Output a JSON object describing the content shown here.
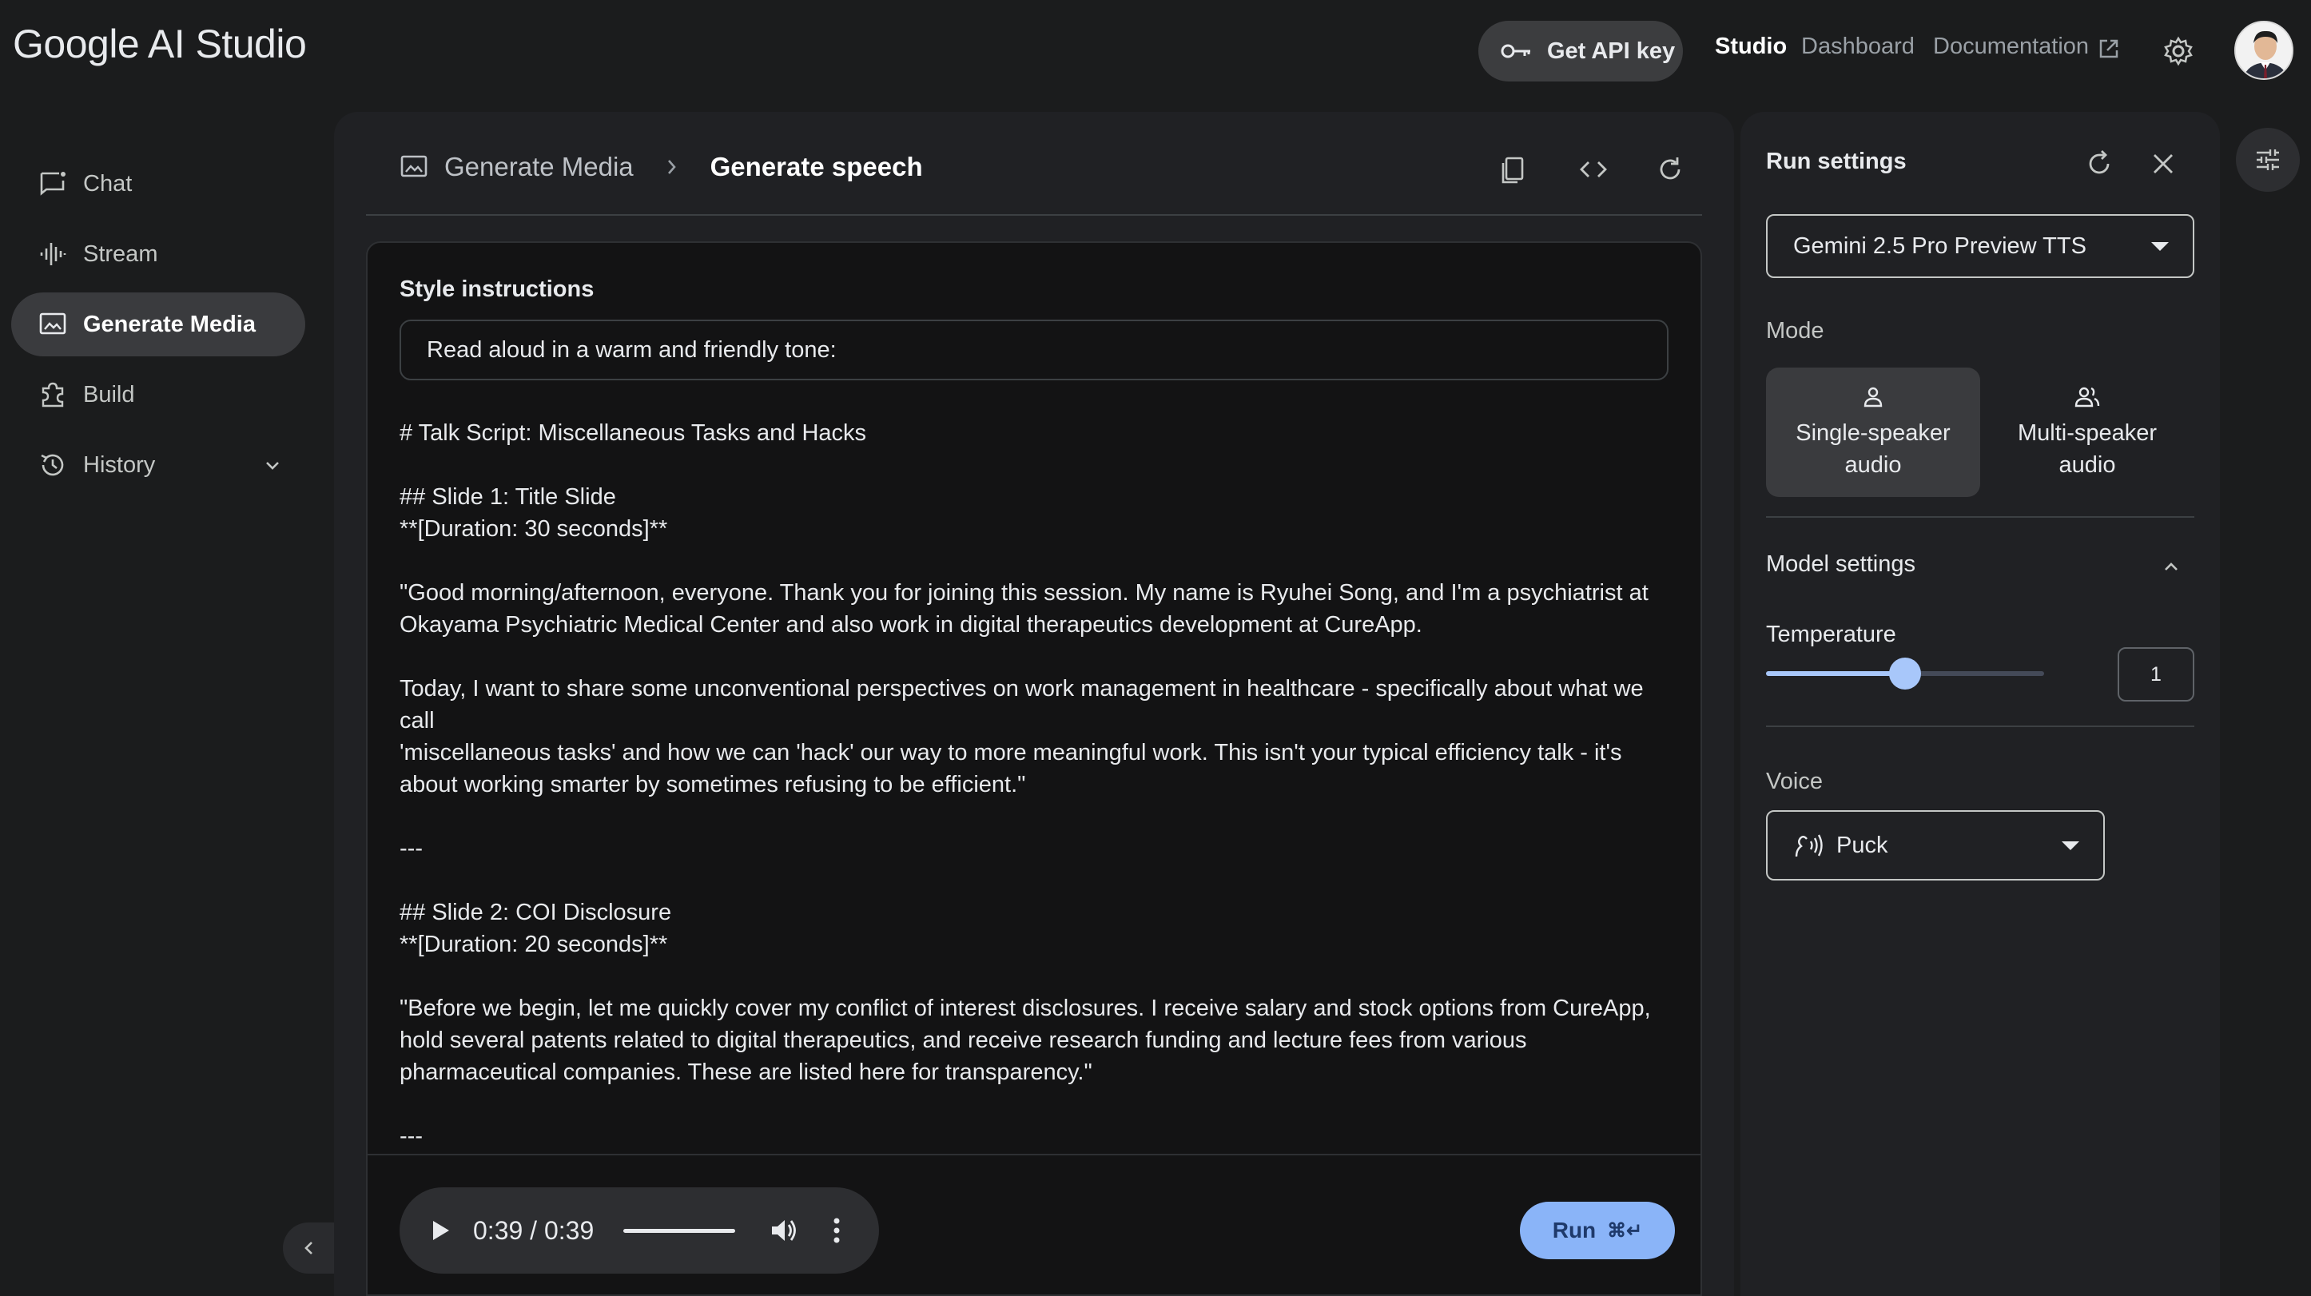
{
  "app": {
    "logo": "Google AI Studio"
  },
  "topbar": {
    "api_key_label": "Get API key",
    "nav": [
      "Studio",
      "Dashboard",
      "Documentation"
    ]
  },
  "sidebar": {
    "items": [
      {
        "label": "Chat",
        "icon": "chat-icon"
      },
      {
        "label": "Stream",
        "icon": "waveform-icon"
      },
      {
        "label": "Generate Media",
        "icon": "image-icon",
        "active": true
      },
      {
        "label": "Build",
        "icon": "puzzle-icon"
      },
      {
        "label": "History",
        "icon": "history-icon"
      }
    ]
  },
  "main": {
    "breadcrumb": [
      "Generate Media",
      "Generate speech"
    ],
    "style_label": "Style instructions",
    "style_value": "Read aloud in a warm and friendly tone:",
    "script": "# Talk Script: Miscellaneous Tasks and Hacks\n\n## Slide 1: Title Slide\n**[Duration: 30 seconds]**\n\n\"Good morning/afternoon, everyone. Thank you for joining this session. My name is Ryuhei Song, and I'm a psychiatrist at\nOkayama Psychiatric Medical Center and also work in digital therapeutics development at CureApp.\n\nToday, I want to share some unconventional perspectives on work management in healthcare - specifically about what we call\n'miscellaneous tasks' and how we can 'hack' our way to more meaningful work. This isn't your typical efficiency talk - it's\nabout working smarter by sometimes refusing to be efficient.\"\n\n---\n\n## Slide 2: COI Disclosure\n**[Duration: 20 seconds]**\n\n\"Before we begin, let me quickly cover my conflict of interest disclosures. I receive salary and stock options from CureApp,\nhold several patents related to digital therapeutics, and receive research funding and lecture fees from various\npharmaceutical companies. These are listed here for transparency.\"\n\n---",
    "player_time": "0:39 / 0:39",
    "run_label": "Run",
    "run_shortcut": "⌘↵"
  },
  "settings": {
    "title": "Run settings",
    "model": "Gemini 2.5 Pro Preview TTS",
    "mode_label": "Mode",
    "modes": [
      {
        "label": "Single-speaker audio",
        "active": true
      },
      {
        "label": "Multi-speaker audio",
        "active": false
      }
    ],
    "model_settings_label": "Model settings",
    "temperature_label": "Temperature",
    "temperature_value": "1",
    "temperature_fraction": 0.5,
    "voice_label": "Voice",
    "voice": "Puck"
  },
  "colors": {
    "accent": "#8ab4f8",
    "slider": "#a8c7fa"
  }
}
